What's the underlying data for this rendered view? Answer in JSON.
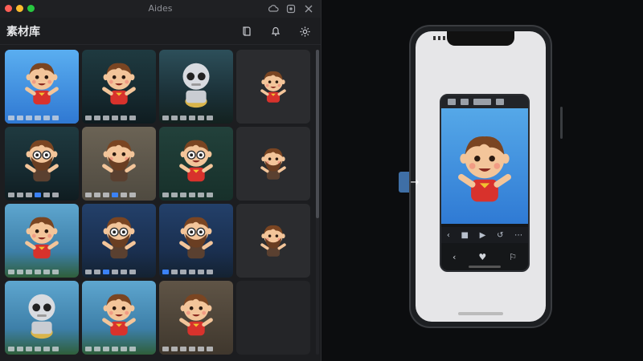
{
  "window": {
    "title": "Aides",
    "colors": {
      "background": "#1c1d20",
      "selection": "#3b82f6"
    }
  },
  "toolbar": {
    "title": "素材库",
    "icons": [
      "book-icon",
      "bell-icon",
      "gear-icon"
    ]
  },
  "grid": {
    "tiles": [
      {
        "bg": "blue",
        "char": "boy"
      },
      {
        "bg": "dark-city",
        "char": "boy"
      },
      {
        "bg": "dark-teal",
        "char": "robot"
      },
      {
        "bg": "plain",
        "char": "boy-small"
      },
      {
        "bg": "dark-city",
        "char": "beard-glasses"
      },
      {
        "bg": "brick",
        "char": "beard"
      },
      {
        "bg": "dark-green",
        "char": "boy-glasses"
      },
      {
        "bg": "plain",
        "char": "beard-small"
      },
      {
        "bg": "sky",
        "char": "boy-laugh"
      },
      {
        "bg": "night-city",
        "char": "beard-glasses"
      },
      {
        "bg": "night-city",
        "char": "beard-glasses-2"
      },
      {
        "bg": "plain",
        "char": "beard-small-2"
      },
      {
        "bg": "sky",
        "char": "robot"
      },
      {
        "bg": "sky",
        "char": "boy-red"
      },
      {
        "bg": "door",
        "char": "boy-wave"
      },
      {
        "bg": "empty",
        "char": ""
      }
    ]
  },
  "arrow": {
    "icon": "arrow-right-icon",
    "symbol": "→"
  },
  "phone": {
    "player": {
      "bar1": [
        "‹",
        "■",
        "▶",
        "↺",
        "⋯"
      ],
      "bar2": [
        "‹",
        "♥",
        "⚐"
      ]
    }
  }
}
